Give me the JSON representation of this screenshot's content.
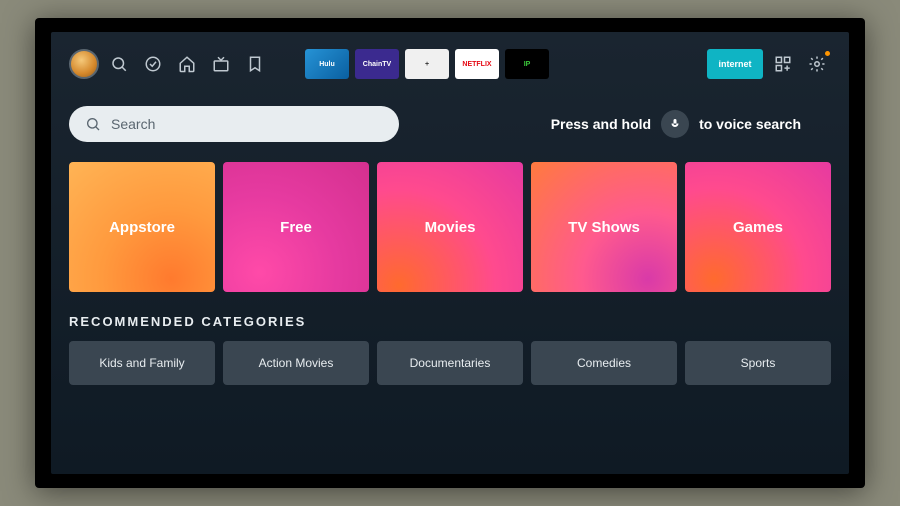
{
  "nav": {
    "apps": [
      {
        "label": "Hulu",
        "bg": "linear-gradient(135deg,#2693d6,#0a5fa0)"
      },
      {
        "label": "ChainTV",
        "bg": "#3b2a8f"
      },
      {
        "label": "+",
        "bg": "#f0f0f0",
        "color": "#333"
      },
      {
        "label": "NETFLIX",
        "bg": "#fff",
        "color": "#e50914"
      },
      {
        "label": "IP",
        "bg": "#000",
        "color": "#3cc93c"
      }
    ],
    "internet_label": "internet"
  },
  "search": {
    "placeholder": "Search",
    "voice_prefix": "Press and hold",
    "voice_suffix": "to voice search"
  },
  "tiles": [
    {
      "label": "Appstore",
      "bg": "radial-gradient(circle at 70% 90%,#ff7a2e 0%,#ff9a3e 45%,#ffb455 100%)"
    },
    {
      "label": "Free",
      "bg": "radial-gradient(circle at 25% 85%,#ff4aa8 0%,#e63aa0 50%,#d4308f 100%)"
    },
    {
      "label": "Movies",
      "bg": "radial-gradient(circle at 15% 95%,#ff6a2e 0%,#ff4a8e 55%,#e63aa0 100%)"
    },
    {
      "label": "TV Shows",
      "bg": "radial-gradient(circle at 80% 90%,#d93aa8 0%,#ff5a8e 40%,#ff7a3e 100%)"
    },
    {
      "label": "Games",
      "bg": "radial-gradient(circle at 20% 90%,#ff6a2e 0%,#ff4a8e 55%,#e63aa0 100%)"
    }
  ],
  "recommended": {
    "title": "RECOMMENDED CATEGORIES",
    "items": [
      "Kids and Family",
      "Action Movies",
      "Documentaries",
      "Comedies",
      "Sports"
    ]
  }
}
